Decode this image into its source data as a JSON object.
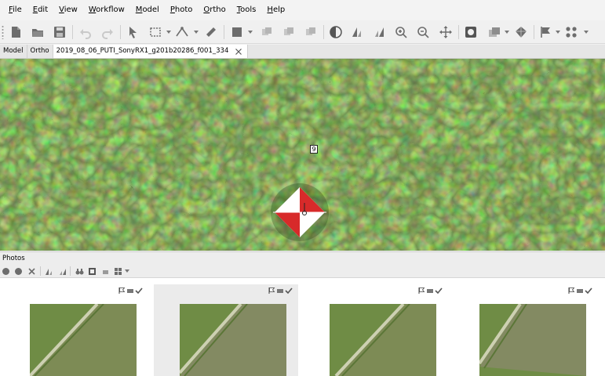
{
  "menu": [
    {
      "label": "File",
      "underline": "F",
      "rest": "ile"
    },
    {
      "label": "Edit",
      "underline": "E",
      "rest": "dit"
    },
    {
      "label": "View",
      "underline": "V",
      "rest": "iew"
    },
    {
      "label": "Workflow",
      "underline": "W",
      "rest": "orkflow"
    },
    {
      "label": "Model",
      "underline": "M",
      "rest": "odel"
    },
    {
      "label": "Photo",
      "underline": "P",
      "rest": "hoto"
    },
    {
      "label": "Ortho",
      "underline": "O",
      "rest": "rtho"
    },
    {
      "label": "Tools",
      "underline": "T",
      "rest": "ools"
    },
    {
      "label": "Help",
      "underline": "H",
      "rest": "elp"
    }
  ],
  "toolbar_icons": [
    "new-document-icon",
    "open-folder-icon",
    "save-icon",
    "undo-icon",
    "redo-icon",
    "pointer-icon",
    "rectangle-selection-icon",
    "polyline-icon",
    "ruler-icon",
    "shaded-mode-icon",
    "mask-icon",
    "mask-add-icon",
    "mask-subtract-icon",
    "contrast-icon",
    "rotate-left-icon",
    "rotate-right-icon",
    "zoom-in-icon",
    "zoom-out-icon",
    "move-icon",
    "frame-icon",
    "layer-icon",
    "mesh-icon",
    "flag-icon",
    "markers-icon"
  ],
  "tabs": {
    "model": "Model",
    "ortho": "Ortho",
    "photo": "2019_08_06_PUTI_SonyRX1_g201b20286_f001_334"
  },
  "viewport": {
    "marker_label": "9",
    "colors": {
      "grass": "#557a32",
      "target_red": "#d72a2a",
      "target_white": "#ffffff"
    }
  },
  "photos_panel": {
    "title": "Photos",
    "toolbar_icons": [
      "add-photo-icon",
      "remove-photo-icon",
      "close-icon",
      "rotate-left-icon",
      "rotate-right-icon",
      "binoculars-icon",
      "frame-icon",
      "camera-icon",
      "view-mode-icon"
    ],
    "thumbnails": [
      {
        "name": "photo-1",
        "selected": false,
        "status_icons": [
          "flag-icon",
          "camera-icon",
          "check-icon"
        ]
      },
      {
        "name": "photo-2",
        "selected": true,
        "status_icons": [
          "flag-icon",
          "camera-icon",
          "check-icon"
        ]
      },
      {
        "name": "photo-3",
        "selected": false,
        "status_icons": [
          "flag-icon",
          "camera-icon",
          "check-icon"
        ]
      },
      {
        "name": "photo-4",
        "selected": false,
        "status_icons": [
          "flag-icon",
          "camera-icon",
          "check-icon"
        ]
      }
    ]
  }
}
